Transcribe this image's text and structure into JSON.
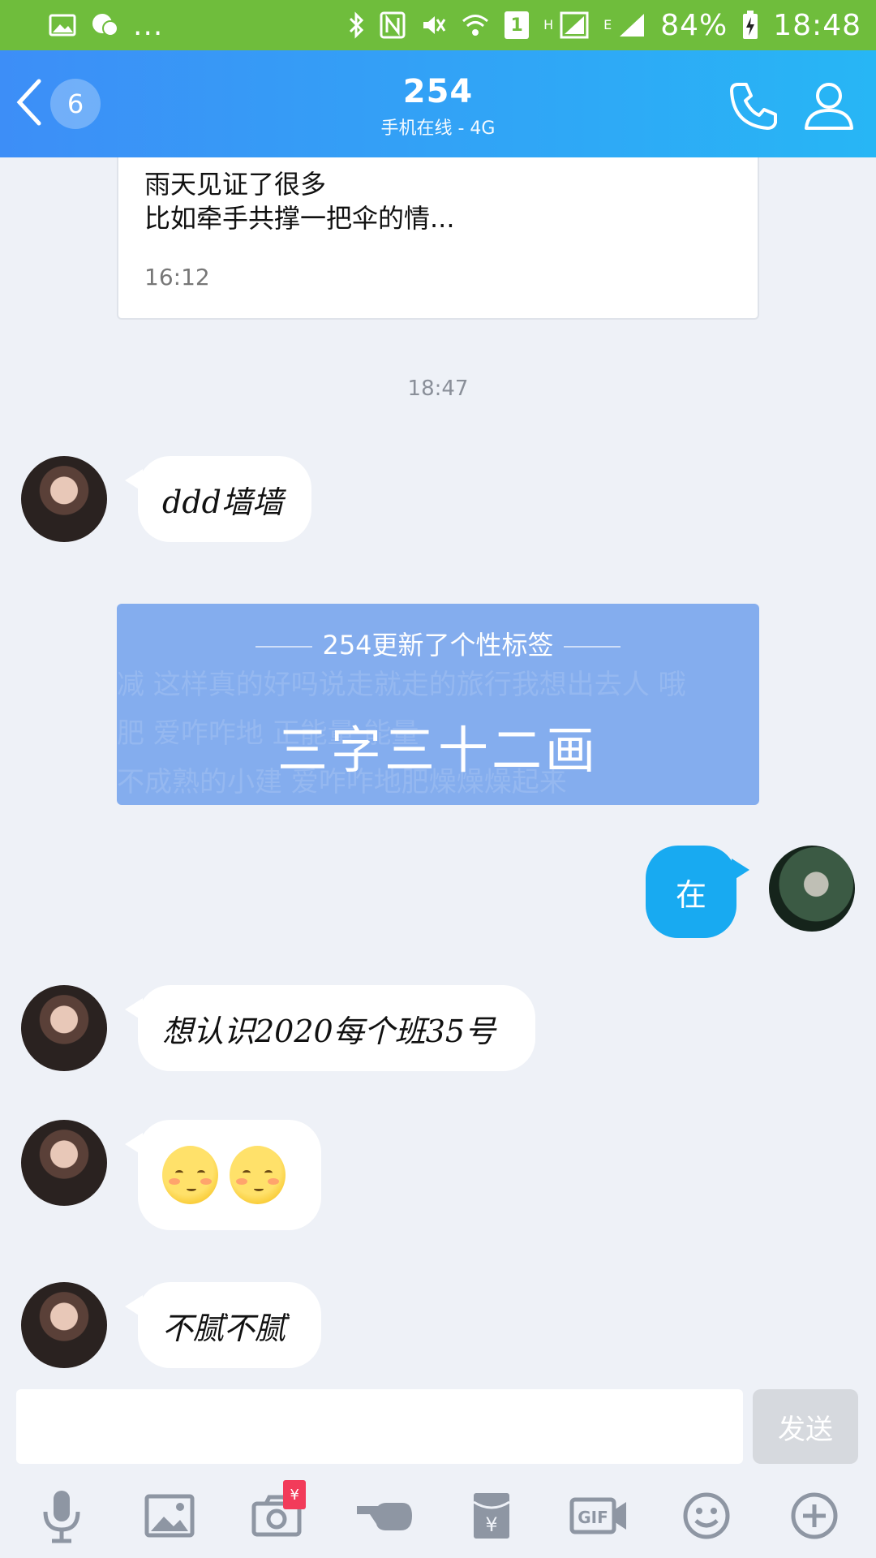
{
  "status_bar": {
    "left_icons": [
      "image-icon",
      "wechat-icon"
    ],
    "more": "...",
    "icons_right": [
      "bluetooth-icon",
      "nfc-icon",
      "mute-icon",
      "wifi-icon",
      "sim-1-icon",
      "signal-h-icon",
      "signal-e-icon",
      "battery-icon"
    ],
    "sim_label": "1",
    "h_label": "H",
    "e_label": "E",
    "battery": "84%",
    "time": "18:48"
  },
  "header": {
    "back_count": "6",
    "title": "254",
    "subtitle": "手机在线 - 4G"
  },
  "messages": {
    "card": {
      "line1": "雨天见证了很多",
      "line2": "比如牵手共撑一把伞的情...",
      "time": "16:12"
    },
    "time_separator": "18:47",
    "msg1": "ddd墙墙",
    "signature": {
      "title": "254更新了个性标签",
      "tag": "三字三十二画",
      "bg_text_1": "减 这样真的好吗说走就走的旅行我想出去人 哦",
      "bg_text_2": "肥 爱咋咋地 正能量 能量",
      "bg_text_3": "不成熟的小建 爱咋咋地肥燥燥燥起来"
    },
    "msg_me": "在",
    "msg2": "想认识2020每个班35号",
    "msg4": "不腻不腻"
  },
  "input": {
    "placeholder": "",
    "send_label": "发送"
  },
  "toolbar": {
    "icons": [
      "mic-icon",
      "image-icon",
      "camera-icon",
      "poke-icon",
      "red-packet-icon",
      "gif-icon",
      "emoji-icon",
      "plus-icon"
    ],
    "camera_badge": "¥",
    "red_packet_symbol": "¥",
    "gif_label": "GIF"
  },
  "colors": {
    "status_bar": "#6fbd3c",
    "header_start": "#3d8ef7",
    "header_end": "#27b6f5",
    "my_bubble": "#18aaf1",
    "signature_card": "#84adee",
    "background": "#eef1f7"
  }
}
